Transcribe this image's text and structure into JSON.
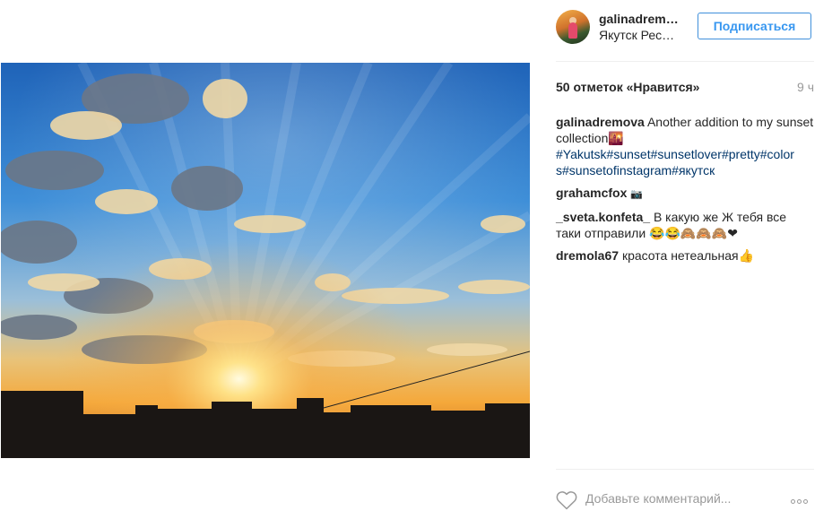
{
  "header": {
    "username": "galinadrem…",
    "location": "Якутск Рес…",
    "follow_label": "Подписаться",
    "follow_color": "#3897f0"
  },
  "post": {
    "image_icon": "sunset-photo",
    "likes": "50 отметок «Нравится»",
    "time": "9 ч"
  },
  "comments": [
    {
      "user": "galinadremova",
      "text": "Another addition to my sunset collection🌇",
      "tags_line1": "#Yakutsk#sunset#sunsetlover#pretty#color",
      "tags_line2": "s#sunsetofinstagram#якутск"
    },
    {
      "user": "grahamcfox",
      "text": "📷"
    },
    {
      "user": "_sveta.konfeta_",
      "text": "В какую же Ж тебя все таки отправили 😂😂🙈🙈🙈❤"
    },
    {
      "user": "dremola67",
      "text": "красота нетеальная👍"
    }
  ],
  "footer": {
    "comment_placeholder": "Добавьте комментарий...",
    "like_icon": "heart-icon",
    "more_icon": "more-options-icon"
  },
  "colors": {
    "hashtag": "#003569",
    "muted": "#999999",
    "text": "#262626"
  }
}
